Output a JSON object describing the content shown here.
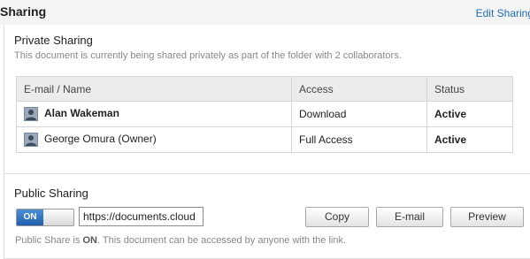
{
  "header": {
    "title": "Sharing",
    "edit_link": "Edit Sharing"
  },
  "private_sharing": {
    "heading": "Private Sharing",
    "description": "This document is currently being shared privately as part of the folder with 2 collaborators.",
    "columns": [
      "E-mail / Name",
      "Access",
      "Status"
    ],
    "rows": [
      {
        "name": "Alan Wakeman",
        "access": "Download",
        "status": "Active",
        "icon": "user-avatar-icon"
      },
      {
        "name": "George Omura (Owner)",
        "access": "Full Access",
        "status": "Active",
        "icon": "user-avatar-icon"
      }
    ]
  },
  "public_sharing": {
    "heading": "Public Sharing",
    "toggle_label": "ON",
    "url_value": "https://documents.cloud",
    "copy_label": "Copy",
    "email_label": "E-mail",
    "preview_label": "Preview",
    "note_prefix": "Public Share is ",
    "note_state": "ON",
    "note_suffix": ". This document can be accessed by anyone with the link."
  },
  "colors": {
    "link": "#1f6bb5",
    "toggle_on": "#2f73c4",
    "muted_text": "#888888"
  }
}
